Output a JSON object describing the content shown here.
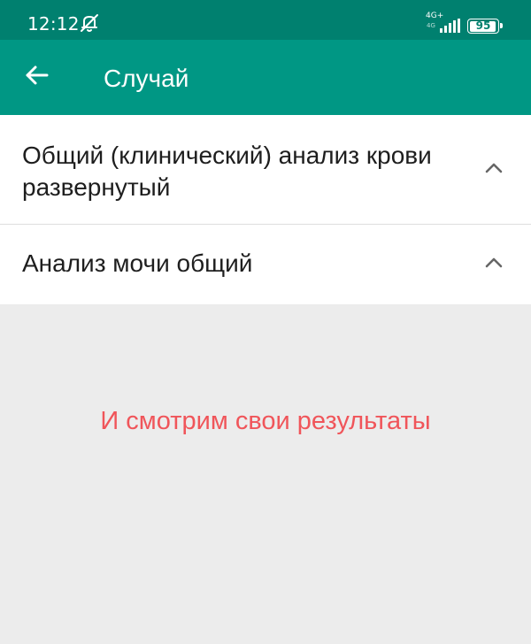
{
  "status_bar": {
    "time": "12:12",
    "mute_icon": "bell-off-icon",
    "network_label": "4G+",
    "network_sub": "4G",
    "battery_level": "95",
    "battery_fraction": 0.95
  },
  "app_bar": {
    "back_icon": "arrow-left-icon",
    "title": "Случай"
  },
  "list": {
    "items": [
      {
        "label": "Общий (клинический) анализ крови развернутый",
        "chevron_icon": "chevron-up-icon"
      },
      {
        "label": "Анализ мочи общий",
        "chevron_icon": "chevron-up-icon"
      }
    ]
  },
  "hint": {
    "text": "И смотрим свои результаты"
  },
  "colors": {
    "status_bar": "#00806f",
    "app_bar": "#009784",
    "background": "#ececec",
    "hint_text": "#f0555a"
  }
}
